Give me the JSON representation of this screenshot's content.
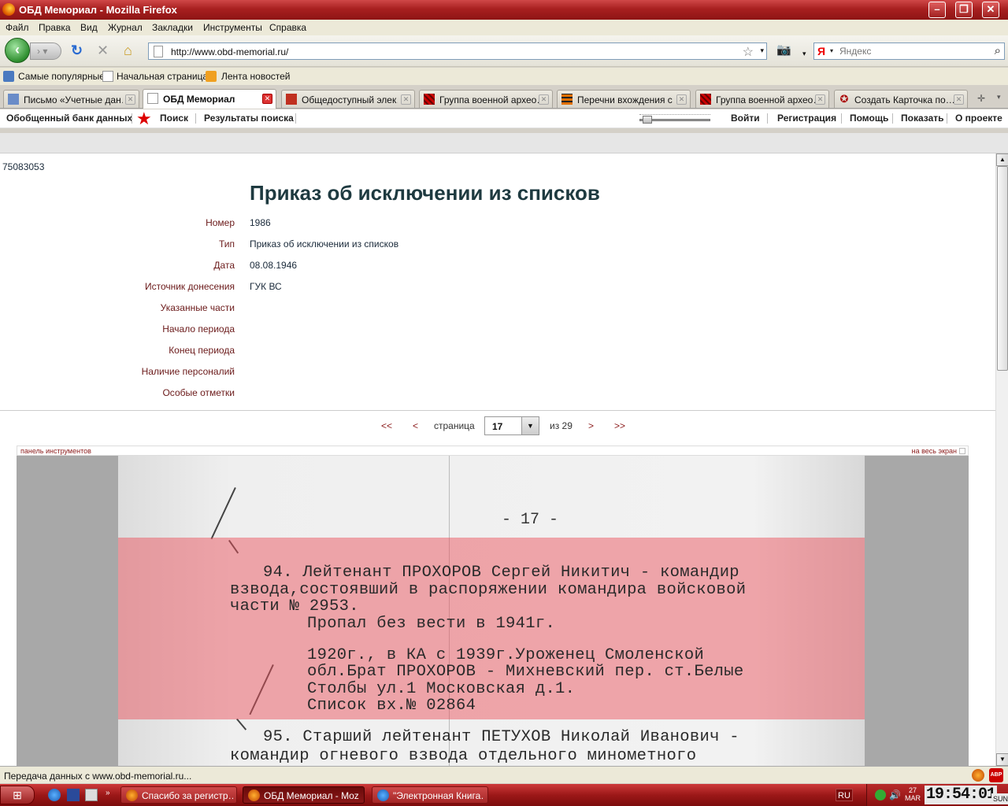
{
  "window": {
    "title": "ОБД Мемориал - Mozilla Firefox"
  },
  "menu": [
    "Файл",
    "Правка",
    "Вид",
    "Журнал",
    "Закладки",
    "Инструменты",
    "Справка"
  ],
  "nav": {
    "url": "http://www.obd-memorial.ru/",
    "search_placeholder": "Яндекс",
    "search_engine": "Я"
  },
  "bookmarks": [
    "Самые популярные",
    "Начальная страница",
    "Лента новостей"
  ],
  "tabs": [
    {
      "label": "Письмо «Учетные дан…",
      "active": false
    },
    {
      "label": "ОБД Мемориал",
      "active": true
    },
    {
      "label": "Общедоступный элек…",
      "active": false
    },
    {
      "label": "Группа военной архео…",
      "active": false
    },
    {
      "label": "Перечни вхождения с…",
      "active": false
    },
    {
      "label": "Группа военной архео…",
      "active": false
    },
    {
      "label": "Создать Карточка по…",
      "active": false
    }
  ],
  "site_nav": {
    "left": [
      "Обобщенный банк данных",
      "Поиск",
      "Результаты поиска"
    ],
    "right": [
      "Войти",
      "Регистрация",
      "Помощь",
      "Показать",
      "О проекте"
    ]
  },
  "doc": {
    "id": "75083053",
    "title": "Приказ об исключении из списков",
    "fields": [
      {
        "label": "Номер",
        "value": "1986"
      },
      {
        "label": "Тип",
        "value": "Приказ об исключении из списков"
      },
      {
        "label": "Дата",
        "value": "08.08.1946"
      },
      {
        "label": "Источник донесения",
        "value": "ГУК ВС"
      },
      {
        "label": "Указанные части",
        "value": ""
      },
      {
        "label": "Начало периода",
        "value": ""
      },
      {
        "label": "Конец периода",
        "value": ""
      },
      {
        "label": "Наличие персоналий",
        "value": ""
      },
      {
        "label": "Особые отметки",
        "value": ""
      }
    ]
  },
  "pager": {
    "first": "<<",
    "prev": "<",
    "page_label": "страница",
    "current": "17",
    "of_label": "из 29",
    "next": ">",
    "last": ">>"
  },
  "viewer": {
    "toolbar_label": "панель инструментов",
    "fullscreen_label": "на весь экран",
    "page_number": "- 17 -",
    "lines": [
      "94. Лейтенант ПРОХОРОВ Сергей Никитич - командир",
      "взвода,состоявший в распоряжении командира войсковой",
      "части № 2953.",
      "Пропал без вести в 1941г.",
      "1920г., в КА с 1939г.Уроженец Смоленской",
      "обл.Брат ПРОХОРОВ - Михневский пер. ст.Белые",
      "Столбы ул.1 Московская д.1.",
      "Список вх.№ 02864",
      "95. Старший лейтенант ПЕТУХОВ Николай Иванович -",
      "командир огневого взвода отдельного минометного"
    ]
  },
  "status": {
    "text": "Передача данных с www.obd-memorial.ru..."
  },
  "taskbar": {
    "tasks": [
      {
        "label": "Спасибо за регистр…",
        "active": false
      },
      {
        "label": "ОБД Мемориал - Moz…",
        "active": true
      },
      {
        "label": "\"Электронная Книга…",
        "active": false
      }
    ],
    "lang": "RU",
    "date_day": "27",
    "date_month": "MAR",
    "clock": "19:54:01",
    "dow": "SUN"
  },
  "colors": {
    "titlebar": "#a82020",
    "field_label": "#6b1a1a",
    "highlight": "#eb505a"
  }
}
